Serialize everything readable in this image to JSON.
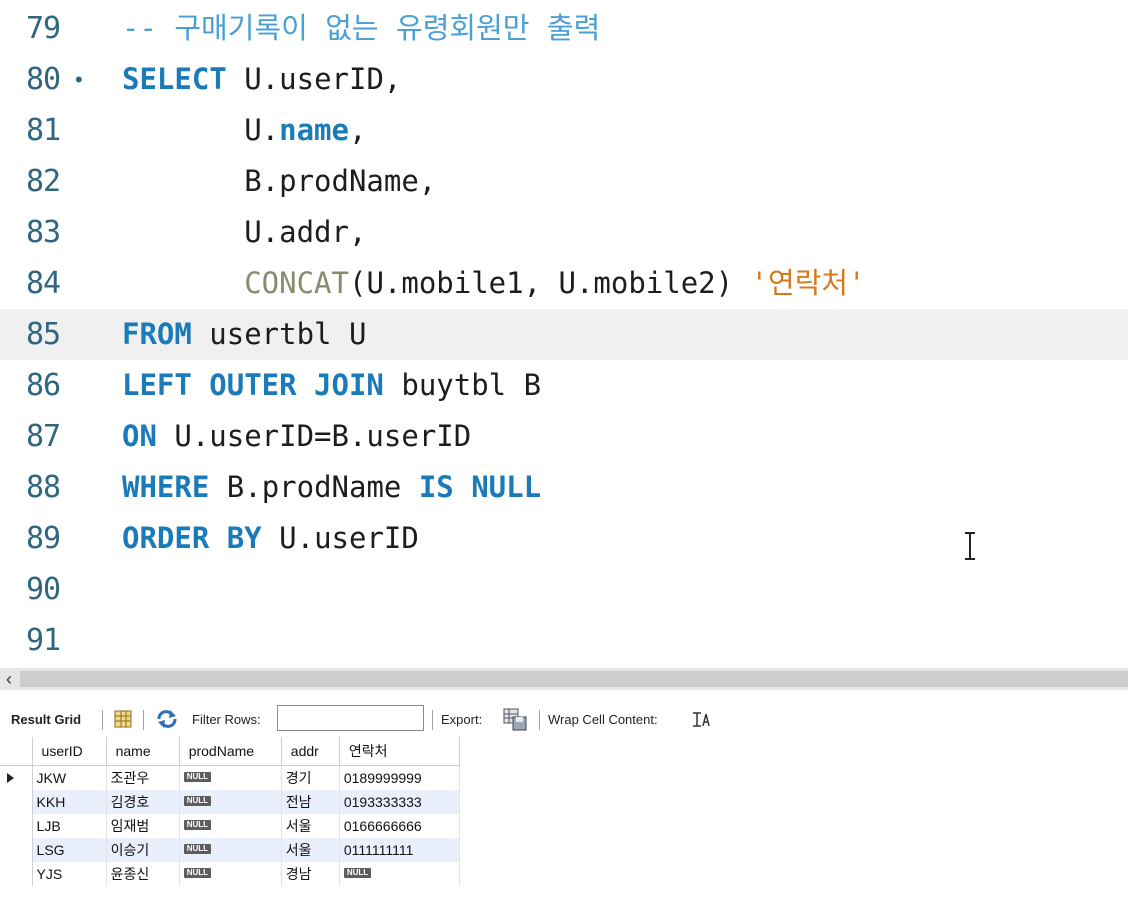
{
  "editor": {
    "lines": [
      {
        "num": "79",
        "segments": [
          {
            "t": "-- 구매기록이 없는 유령회원만 출력",
            "c": "cm"
          }
        ]
      },
      {
        "num": "80",
        "fold": "•",
        "segments": [
          {
            "t": "SELECT",
            "c": "kw"
          },
          {
            "t": " U.userID,",
            "c": ""
          }
        ]
      },
      {
        "num": "81",
        "segments": [
          {
            "t": "       U.",
            "c": ""
          },
          {
            "t": "name",
            "c": "kw"
          },
          {
            "t": ",",
            "c": ""
          }
        ]
      },
      {
        "num": "82",
        "segments": [
          {
            "t": "       B.prodName,",
            "c": ""
          }
        ]
      },
      {
        "num": "83",
        "segments": [
          {
            "t": "       U.addr,",
            "c": ""
          }
        ]
      },
      {
        "num": "84",
        "segments": [
          {
            "t": "       ",
            "c": ""
          },
          {
            "t": "CONCAT",
            "c": "fn"
          },
          {
            "t": "(U.mobile1, U.mobile2) ",
            "c": ""
          },
          {
            "t": "'연락처'",
            "c": "str"
          }
        ]
      },
      {
        "num": "85",
        "current": true,
        "segments": [
          {
            "t": "FROM",
            "c": "kw"
          },
          {
            "t": " usertbl U",
            "c": ""
          }
        ]
      },
      {
        "num": "86",
        "segments": [
          {
            "t": "LEFT OUTER JOIN",
            "c": "kw"
          },
          {
            "t": " buytbl B",
            "c": ""
          }
        ]
      },
      {
        "num": "87",
        "segments": [
          {
            "t": "ON",
            "c": "kw"
          },
          {
            "t": " U.userID=B.userID",
            "c": ""
          }
        ]
      },
      {
        "num": "88",
        "segments": [
          {
            "t": "WHERE",
            "c": "kw"
          },
          {
            "t": " B.prodName ",
            "c": ""
          },
          {
            "t": "IS NULL",
            "c": "kw"
          }
        ]
      },
      {
        "num": "89",
        "segments": [
          {
            "t": "ORDER BY",
            "c": "kw"
          },
          {
            "t": " U.userID",
            "c": ""
          }
        ]
      },
      {
        "num": "90",
        "segments": []
      },
      {
        "num": "91",
        "segments": []
      }
    ]
  },
  "toolbar": {
    "result_grid": "Result Grid",
    "filter_rows": "Filter Rows:",
    "filter_value": "",
    "export": "Export:",
    "wrap_cell": "Wrap Cell Content:"
  },
  "grid": {
    "columns": [
      "userID",
      "name",
      "prodName",
      "addr",
      "연락처"
    ],
    "null_label": "NULL",
    "rows": [
      [
        "JKW",
        "조관우",
        null,
        "경기",
        "0189999999"
      ],
      [
        "KKH",
        "김경호",
        null,
        "전남",
        "0193333333"
      ],
      [
        "LJB",
        "임재범",
        null,
        "서울",
        "0166666666"
      ],
      [
        "LSG",
        "이승기",
        null,
        "서울",
        "0111111111"
      ],
      [
        "YJS",
        "윤종신",
        null,
        "경남",
        null
      ]
    ]
  },
  "colors": {
    "keyword": "#1b7ab8",
    "function": "#8a8a6e",
    "string": "#d37a1e",
    "comment": "#4a9fd4",
    "line_number": "#2f6680"
  }
}
